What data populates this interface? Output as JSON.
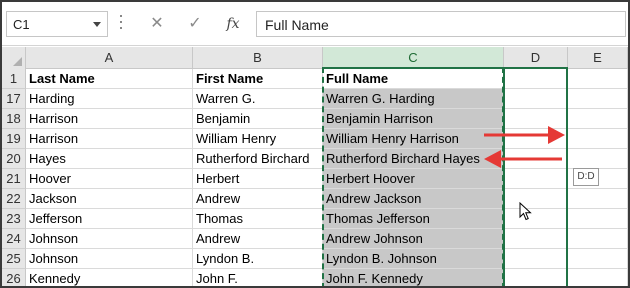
{
  "formula_bar": {
    "name_box": "C1",
    "cancel_symbol": "✕",
    "enter_symbol": "✓",
    "insert_function": "fx",
    "formula": "Full Name"
  },
  "columns": [
    "A",
    "B",
    "C",
    "D",
    "E"
  ],
  "header_row": {
    "row": "1",
    "last_name": "Last Name",
    "first_name": "First Name",
    "full_name": "Full Name"
  },
  "rows": [
    {
      "row": "17",
      "last": "Harding",
      "first": "Warren G.",
      "full": "Warren G.  Harding"
    },
    {
      "row": "18",
      "last": "Harrison",
      "first": "Benjamin",
      "full": "Benjamin  Harrison"
    },
    {
      "row": "19",
      "last": "Harrison",
      "first": "William Henry",
      "full": "William Henry  Harrison"
    },
    {
      "row": "20",
      "last": "Hayes",
      "first": "Rutherford Birchard",
      "full": "Rutherford Birchard  Hayes"
    },
    {
      "row": "21",
      "last": "Hoover",
      "first": "Herbert",
      "full": "Herbert  Hoover"
    },
    {
      "row": "22",
      "last": "Jackson",
      "first": "Andrew",
      "full": "Andrew  Jackson"
    },
    {
      "row": "23",
      "last": "Jefferson",
      "first": "Thomas",
      "full": "Thomas  Jefferson"
    },
    {
      "row": "24",
      "last": "Johnson",
      "first": "Andrew",
      "full": "Andrew  Johnson"
    },
    {
      "row": "25",
      "last": "Johnson",
      "first": "Lyndon B.",
      "full": "Lyndon B.  Johnson"
    },
    {
      "row": "26",
      "last": "Kennedy",
      "first": "John F.",
      "full": "John F.  Kennedy"
    }
  ],
  "tooltip": "D:D",
  "colors": {
    "selection_green": "#217346",
    "arrow_red": "#e53935",
    "shaded_cell": "#c8c8c8"
  }
}
